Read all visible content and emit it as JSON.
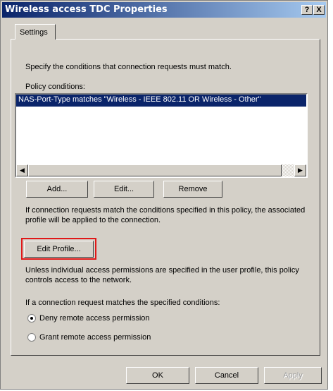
{
  "window": {
    "title": "Wireless access TDC Properties",
    "help_button": "?",
    "close_button": "X"
  },
  "tabs": [
    {
      "label": "Settings"
    }
  ],
  "settings": {
    "intro": "Specify the conditions that connection requests must match.",
    "policy_conditions_label": "Policy conditions:",
    "conditions": [
      "NAS-Port-Type matches \"Wireless - IEEE 802.11 OR Wireless - Other\""
    ],
    "add_button": "Add...",
    "edit_button": "Edit...",
    "remove_button": "Remove",
    "profile_note": "If connection requests match the conditions specified in this policy, the associated profile will be applied to the connection.",
    "edit_profile_button": "Edit Profile...",
    "permissions_note": "Unless individual access permissions are specified in the user profile, this policy controls access to the network.",
    "match_label": "If a connection request matches the specified conditions:",
    "radio_options": [
      {
        "label": "Deny remote access permission",
        "selected": true
      },
      {
        "label": "Grant remote access permission",
        "selected": false
      }
    ]
  },
  "footer": {
    "ok": "OK",
    "cancel": "Cancel",
    "apply": "Apply"
  },
  "colors": {
    "titlebar_start": "#0a246a",
    "titlebar_end": "#a6caf0",
    "selection": "#0a246a",
    "highlight_box": "#e01818",
    "dialog_face": "#d4d0c8"
  }
}
